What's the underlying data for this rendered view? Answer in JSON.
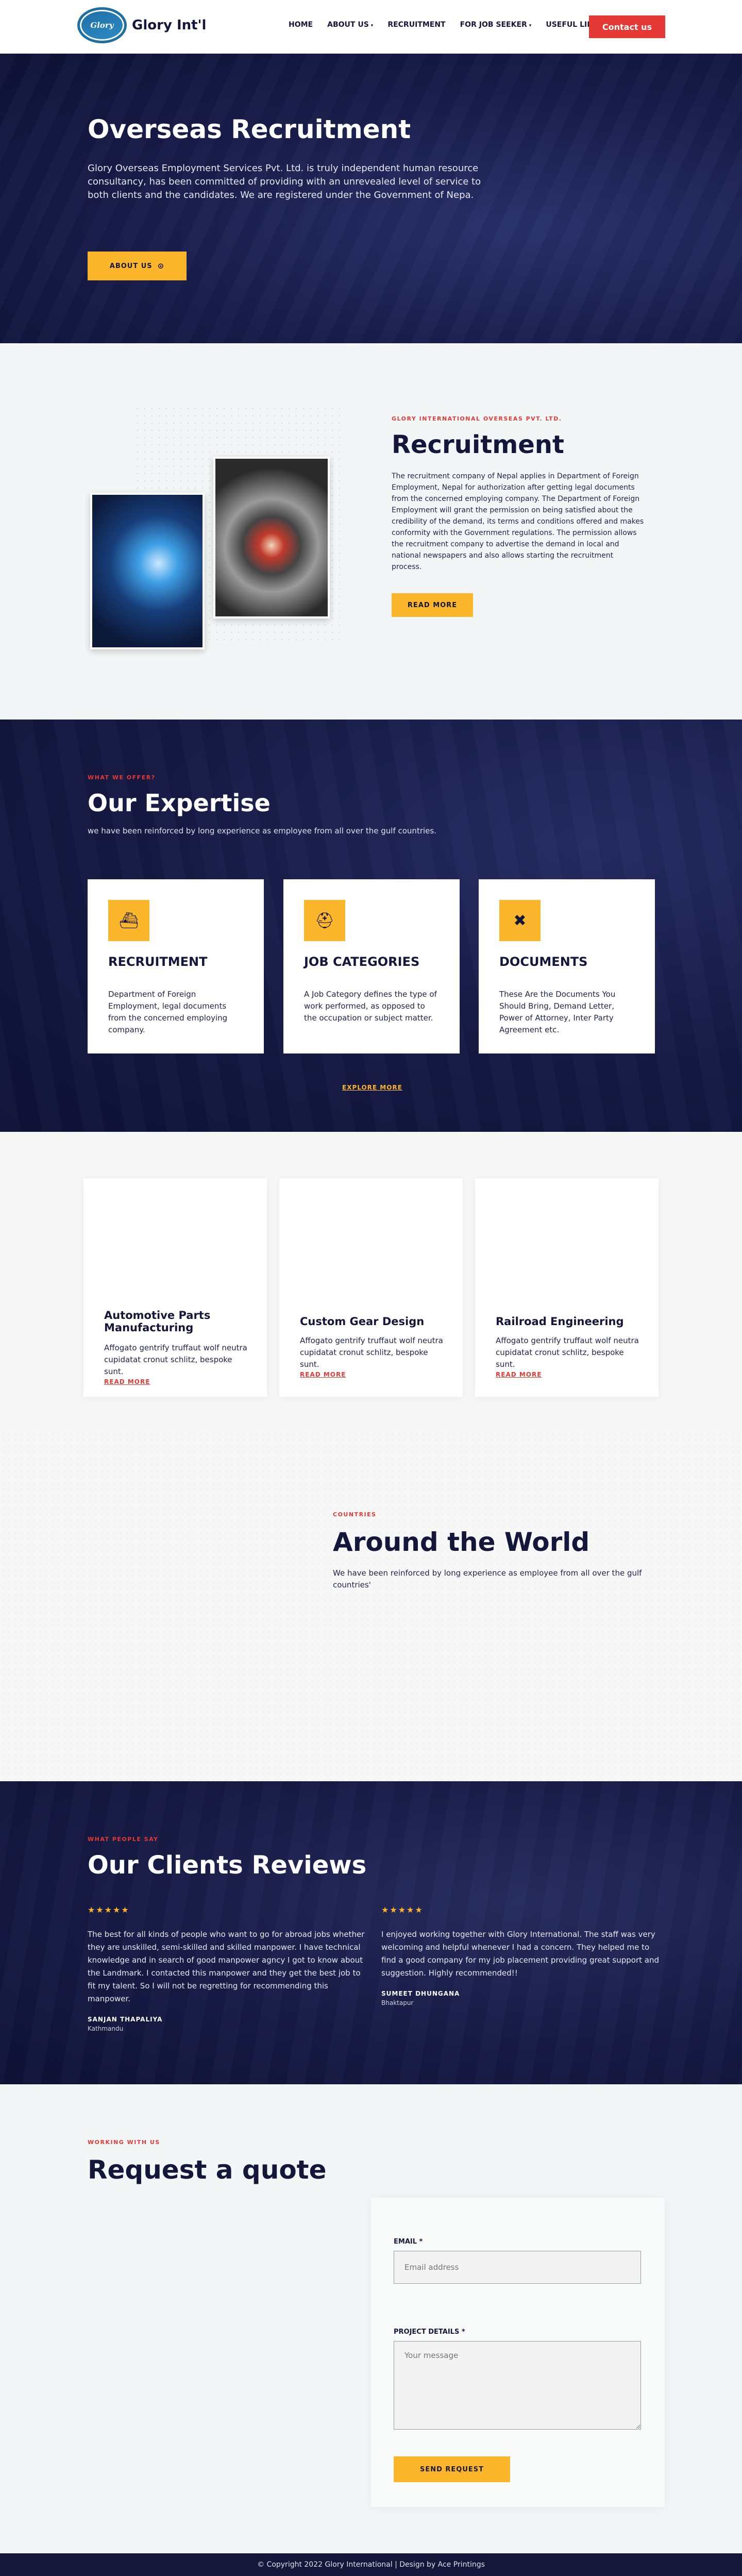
{
  "header": {
    "logo_mark": "Glory",
    "logo_text": "Glory Int'l",
    "nav": [
      {
        "label": "HOME",
        "caret": ""
      },
      {
        "label": "ABOUT US",
        "caret": "▾"
      },
      {
        "label": "RECRUITMENT",
        "caret": ""
      },
      {
        "label": "FOR JOB SEEKER",
        "caret": "▾"
      },
      {
        "label": "USEFUL LINKS",
        "caret": ""
      }
    ],
    "contact_label": "Contact us"
  },
  "hero": {
    "title": "Overseas Recruitment",
    "text": "Glory Overseas Employment Services Pvt. Ltd. is truly independent human resource consultancy, has been committed of providing with an unrevealed level of service to both clients and the candidates. We are registered under the Government of Nepa.",
    "button_label": "ABOUT US",
    "button_icon": "⊙"
  },
  "recruitment": {
    "eyebrow": "GLORY INTERNATIONAL OVERSEAS PVT. LTD.",
    "title": "Recruitment",
    "text": "The recruitment company of Nepal applies in Department of Foreign Employment, Nepal for authorization after getting legal documents from the concerned employing company. The Department of Foreign Employment will grant the permission on being satisfied about the credibility of the demand, its terms and conditions offered and makes conformity with the Government regulations. The permission allows the recruitment company to advertise the demand in local and national newspapers and also allows starting the recruitment process.",
    "button_label": "READ MORE"
  },
  "expertise": {
    "eyebrow": "WHAT WE OFFER?",
    "title": "Our Expertise",
    "subtitle": "we have been reinforced by long experience as employee from all over the gulf countries.",
    "cards": [
      {
        "icon": "ship-icon",
        "glyph": "⛴",
        "title": "RECRUITMENT",
        "text": "Department of Foreign Employment, legal documents from the concerned employing company."
      },
      {
        "icon": "hardhat-icon",
        "glyph": "⛑",
        "title": "JOB CATEGORIES",
        "text": "A Job Category defines the type of work performed, as opposed to the occupation or subject matter."
      },
      {
        "icon": "tools-icon",
        "glyph": "✖",
        "title": "DOCUMENTS",
        "text": "These Are the Documents You Should Bring, Demand Letter, Power of Attorney, Inter Party Agreement etc."
      }
    ],
    "explore_label": "EXPLORE MORE"
  },
  "services": [
    {
      "title": "Automotive Parts Manufacturing",
      "text": "Affogato gentrify truffaut wolf neutra cupidatat cronut schlitz, bespoke sunt.",
      "link": "READ MORE"
    },
    {
      "title": "Custom Gear Design",
      "text": "Affogato gentrify truffaut wolf neutra cupidatat cronut schlitz, bespoke sunt.",
      "link": "READ MORE"
    },
    {
      "title": "Railroad Engineering",
      "text": "Affogato gentrify truffaut wolf neutra cupidatat cronut schlitz, bespoke sunt.",
      "link": "READ MORE"
    }
  ],
  "world": {
    "eyebrow": "COUNTRIES",
    "title": "Around the World",
    "text": "We have been reinforced by long experience as employee from all over the gulf countries'"
  },
  "reviews": {
    "eyebrow": "WHAT PEOPLE SAY",
    "title": "Our Clients Reviews",
    "items": [
      {
        "stars": "★★★★★",
        "text": "The best for all kinds of people who want to go for abroad jobs whether they are unskilled, semi-skilled and skilled manpower. I have technical knowledge and in search of good manpower agncy I got to know about the Landmark. I contacted this manpower and they get the best job to fit my talent. So I will not be regretting for recommending this manpower.",
        "name": "SANJAN THAPALIYA",
        "location": "Kathmandu"
      },
      {
        "stars": "★★★★★",
        "text": "I enjoyed working together with Glory International. The staff was very welcoming and helpful whenever I had a concern. They helped me to find a good company for my job placement providing great support and suggestion. Highly recommended!!",
        "name": "SUMEET DHUNGANA",
        "location": "Bhaktapur"
      }
    ]
  },
  "quote": {
    "eyebrow": "WORKING WITH US",
    "title": "Request a quote",
    "email_label": "EMAIL *",
    "email_placeholder": "Email address",
    "details_label": "PROJECT DETAILS *",
    "details_placeholder": "Your message",
    "submit_label": "SEND REQUEST"
  },
  "footer": {
    "text": "© Copyright 2022 Glory International | Design by Ace Printings"
  },
  "colors": {
    "navy": "#14163a",
    "accent_yellow": "#fbb62b",
    "accent_red": "#e53935"
  }
}
